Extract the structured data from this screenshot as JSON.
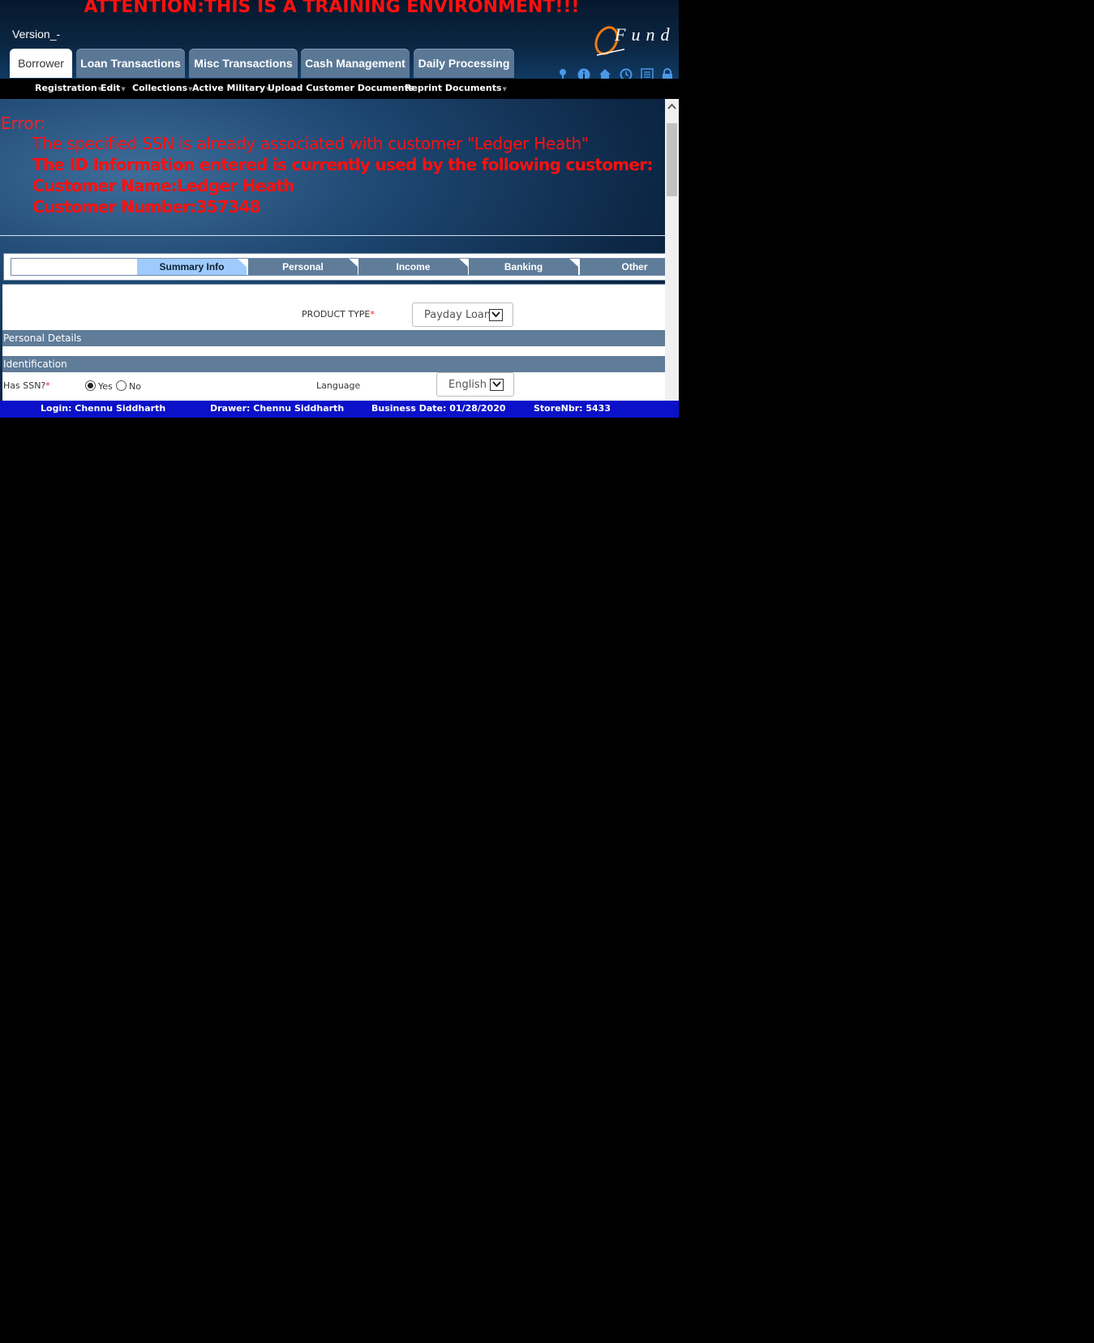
{
  "header": {
    "attention": "ATTENTION:THIS IS A TRAINING ENVIRONMENT!!!",
    "version": "Version_-",
    "logo_text": "Fund"
  },
  "main_tabs": [
    {
      "label": "Borrower",
      "active": true
    },
    {
      "label": "Loan Transactions",
      "active": false
    },
    {
      "label": "Misc Transactions",
      "active": false
    },
    {
      "label": "Cash Management",
      "active": false
    },
    {
      "label": "Daily Processing",
      "active": false
    }
  ],
  "utility_icons": [
    "pin-icon",
    "info-icon",
    "home-icon",
    "clock-icon",
    "list-icon",
    "lock-icon"
  ],
  "submenu": [
    {
      "label": "Registration",
      "has_dropdown": true
    },
    {
      "label": "Edit",
      "has_dropdown": true
    },
    {
      "label": "Collections",
      "has_dropdown": true
    },
    {
      "label": "Active Military",
      "has_dropdown": true
    },
    {
      "label": "Upload Customer Documents",
      "has_dropdown": false
    },
    {
      "label": "Reprint Documents",
      "has_dropdown": true
    }
  ],
  "error": {
    "title": "Error:",
    "line1": "The specified SSN is already associated with customer \"Ledger Heath\"",
    "line2": "The ID Information entered is currently used by the following customer:",
    "line3": "Customer Name:Ledger Heath",
    "line4": "Customer Number:357348"
  },
  "sub_tabs": [
    {
      "label": "Summary Info",
      "active": true
    },
    {
      "label": "Personal",
      "active": false
    },
    {
      "label": "Income",
      "active": false
    },
    {
      "label": "Banking",
      "active": false
    },
    {
      "label": "Other",
      "active": false
    }
  ],
  "form": {
    "product_type_label": "PRODUCT TYPE",
    "required_mark": "*",
    "product_type_value": "Payday Loan",
    "section_personal": "Personal Details",
    "section_identification": "Identification",
    "has_ssn_label": "Has SSN?",
    "has_ssn_yes": "Yes",
    "has_ssn_no": "No",
    "has_ssn_selected": "Yes",
    "language_label": "Language",
    "language_value": "English"
  },
  "footer": {
    "login": "Login: Chennu Siddharth",
    "drawer": "Drawer: Chennu Siddharth",
    "business_date": "Business Date: 01/28/2020",
    "store": "StoreNbr: 5433"
  },
  "colors": {
    "error_red": "#ff1010",
    "tab_blue": "#5f7c99",
    "active_subtab": "#9ecbfb",
    "footer_blue": "#0b11c8",
    "icon_blue": "#4b98e8",
    "logo_orange": "#f07a10"
  }
}
